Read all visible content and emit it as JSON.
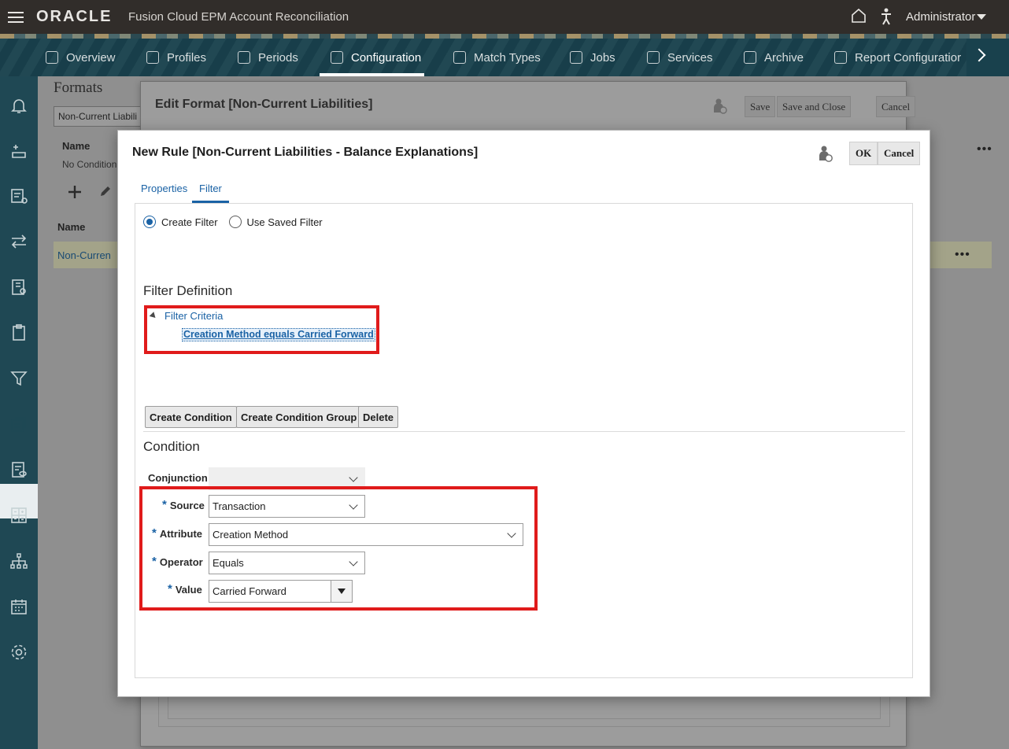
{
  "header": {
    "logo": "ORACLE",
    "product": "Fusion Cloud EPM Account Reconciliation",
    "user": "Administrator"
  },
  "nav": {
    "items": [
      {
        "label": "Overview",
        "icon": "overview-icon"
      },
      {
        "label": "Profiles",
        "icon": "profiles-icon"
      },
      {
        "label": "Periods",
        "icon": "periods-icon"
      },
      {
        "label": "Configuration",
        "icon": "configuration-icon",
        "active": true
      },
      {
        "label": "Match Types",
        "icon": "match-types-icon"
      },
      {
        "label": "Jobs",
        "icon": "jobs-icon"
      },
      {
        "label": "Services",
        "icon": "services-icon"
      },
      {
        "label": "Archive",
        "icon": "archive-icon"
      },
      {
        "label": "Report Configuratior",
        "icon": "report-configuration-icon"
      }
    ]
  },
  "background_page": {
    "title": "Formats",
    "search_value": "Non-Current Liabili",
    "col_name_top": "Name",
    "no_conditions": "No Condition",
    "col_name": "Name",
    "row_link": "Non-Curren",
    "more": "•••"
  },
  "edit_dialog": {
    "title": "Edit Format [Non-Current Liabilities]",
    "save": "Save",
    "save_close": "Save and Close",
    "cancel": "Cancel"
  },
  "rule_dialog": {
    "title": "New Rule [Non-Current Liabilities - Balance Explanations]",
    "ok": "OK",
    "cancel": "Cancel",
    "tabs": [
      {
        "label": "Properties",
        "active": false
      },
      {
        "label": "Filter",
        "active": true
      }
    ],
    "radio_create": "Create Filter",
    "radio_saved": "Use Saved Filter",
    "radio_selected": "create",
    "filter_definition_title": "Filter Definition",
    "filter_criteria_label": "Filter Criteria",
    "filter_criteria_item": "Creation Method equals Carried Forward",
    "buttons": {
      "create_condition": "Create Condition",
      "create_condition_group": "Create Condition Group",
      "delete": "Delete"
    },
    "condition_title": "Condition",
    "fields": {
      "conjunction": {
        "label": "Conjunction",
        "value": ""
      },
      "source": {
        "label": "Source",
        "value": "Transaction",
        "required": true
      },
      "attribute": {
        "label": "Attribute",
        "value": "Creation Method",
        "required": true
      },
      "operator": {
        "label": "Operator",
        "value": "Equals",
        "required": true
      },
      "value": {
        "label": "Value",
        "value": "Carried Forward",
        "required": true
      }
    }
  },
  "colors": {
    "header_bg": "#312d2a",
    "nav_bg": "#19414d",
    "rail_bg": "#1f4854",
    "link_blue": "#1a62a5",
    "highlight_red": "#e01b1b"
  }
}
